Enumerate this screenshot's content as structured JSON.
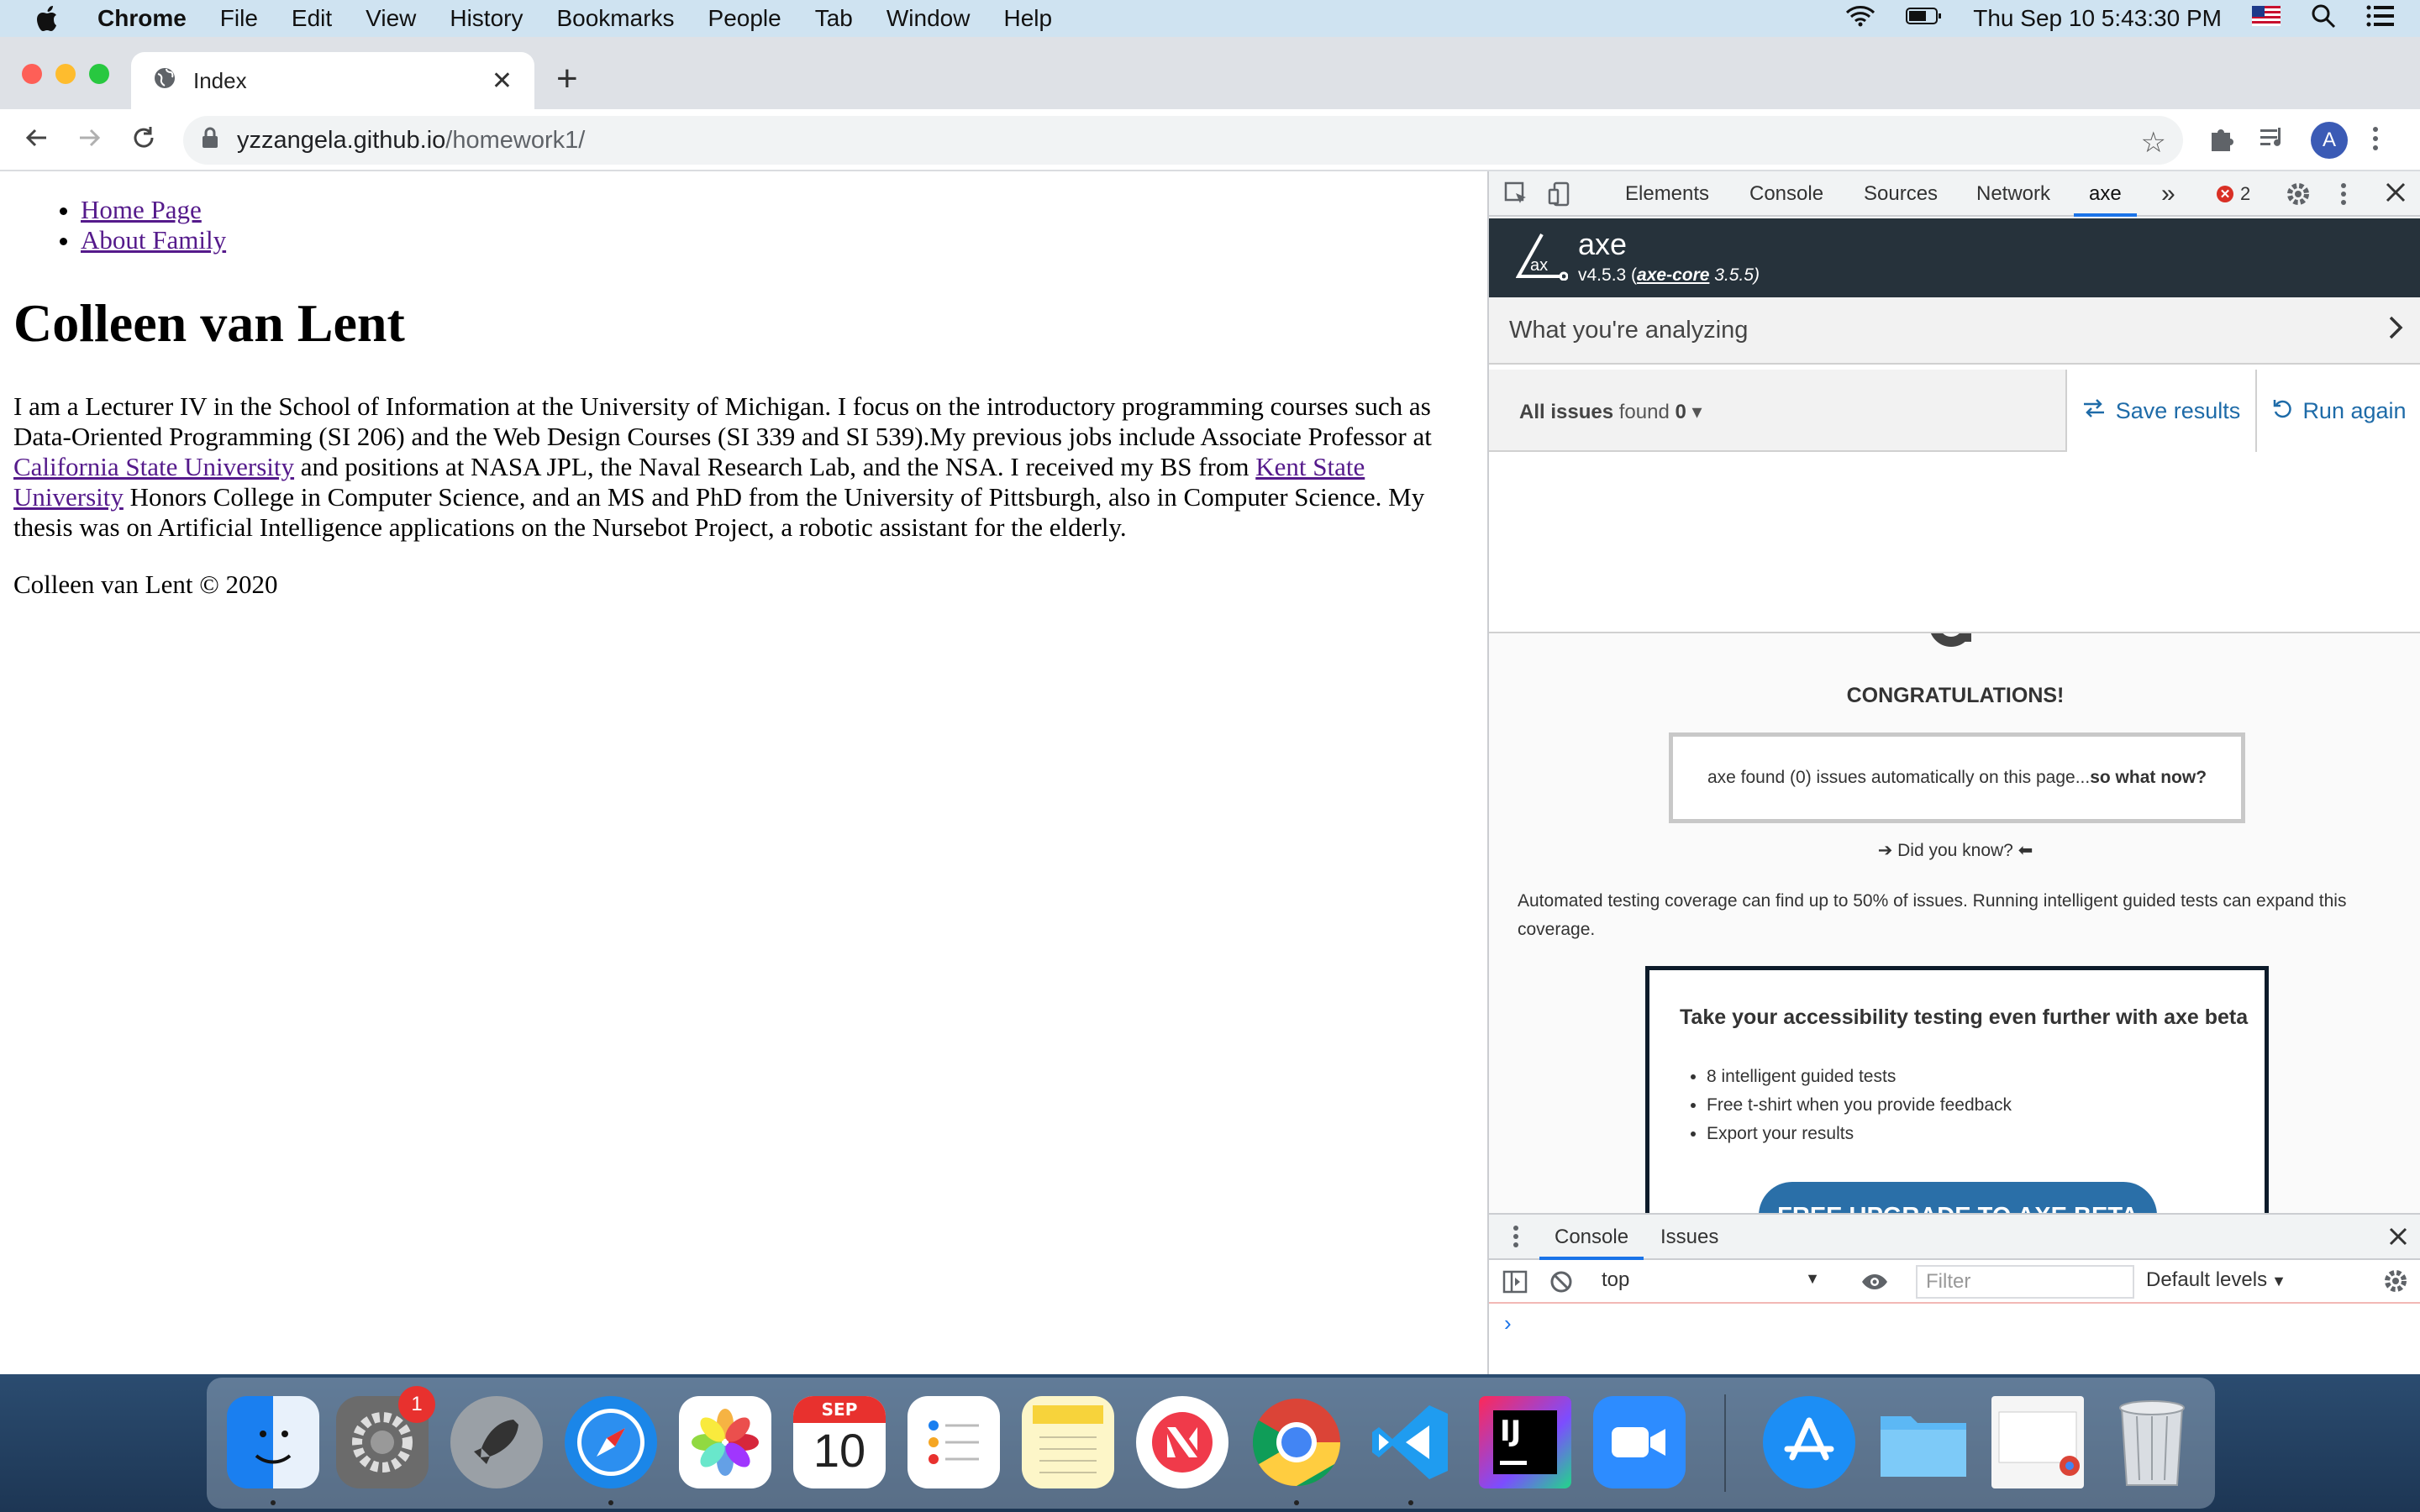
{
  "menubar": {
    "app": "Chrome",
    "items": [
      "File",
      "Edit",
      "View",
      "History",
      "Bookmarks",
      "People",
      "Tab",
      "Window",
      "Help"
    ],
    "datetime": "Thu Sep 10  5:43:30 PM"
  },
  "browser": {
    "tab_title": "Index",
    "url_host": "yzzangela.github.io",
    "url_path": "/homework1/",
    "avatar_letter": "A"
  },
  "page": {
    "nav": [
      "Home Page",
      "About Family"
    ],
    "heading": "Colleen van Lent",
    "bio_1": "I am a Lecturer IV in the School of Information at the University of Michigan. I focus on the introductory programming courses such as Data-Oriented Programming (SI 206) and the Web Design Courses (SI 339 and SI 539).My previous jobs include Associate Professor at ",
    "bio_link_1": "California State University",
    "bio_2": " and positions at NASA JPL, the Naval Research Lab, and the NSA. I received my BS from ",
    "bio_link_2": "Kent State University",
    "bio_3": " Honors College in Computer Science, and an MS and PhD from the University of Pittsburgh, also in Computer Science. My thesis was on Artificial Intelligence applications on the Nursebot Project, a robotic assistant for the elderly.",
    "footer": "Colleen van Lent © 2020"
  },
  "devtools": {
    "tabs": [
      "Elements",
      "Console",
      "Sources",
      "Network",
      "axe"
    ],
    "more": "»",
    "error_count": "2",
    "axe": {
      "name": "axe",
      "version_prefix": "v4.5.3 (",
      "core_link": "axe-core",
      "core_version": " 3.5.5)",
      "analyzing": "What you're analyzing",
      "issues_label": "All issues",
      "issues_found": " found ",
      "issues_count": "0",
      "save_results": "Save results",
      "run_again": "Run again",
      "congrats": "CONGRATULATIONS!",
      "found_text": "axe found (0) issues automatically on this page...",
      "found_bold": "so what now?",
      "did_you_know": "Did you know?",
      "coverage": "Automated testing coverage can find up to 50% of issues. Running intelligent guided tests can expand this coverage.",
      "beta_title": "Take your accessibility testing even further with axe beta",
      "beta_items": [
        "8 intelligent guided tests",
        "Free t-shirt when you provide feedback",
        "Export your results"
      ],
      "upgrade": "FREE UPGRADE TO AXE BETA"
    },
    "drawer": {
      "tabs": [
        "Console",
        "Issues"
      ],
      "context": "top",
      "filter_placeholder": "Filter",
      "levels": "Default levels"
    }
  },
  "dock": {
    "calendar_month": "SEP",
    "calendar_day": "10",
    "prefs_badge": "1",
    "intellij": "IJ"
  }
}
